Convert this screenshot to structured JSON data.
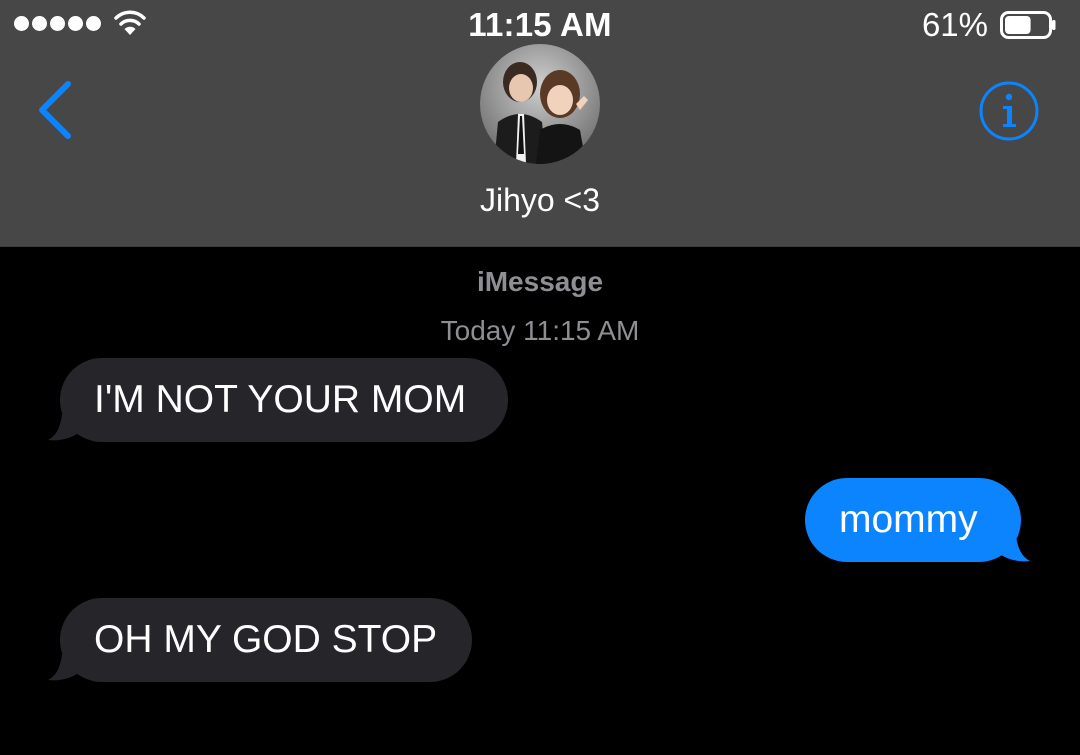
{
  "status_bar": {
    "time": "11:15 AM",
    "battery_percent": "61%",
    "battery_level": 0.61,
    "signal_dots": 5,
    "wifi_icon": "wifi-icon"
  },
  "header": {
    "back_icon": "chevron-left-icon",
    "avatar": "contact-photo",
    "contact_name": "Jihyo <3",
    "info_icon": "info-icon"
  },
  "conversation": {
    "service": "iMessage",
    "timestamp": "Today 11:15 AM",
    "messages": [
      {
        "direction": "incoming",
        "text": "I'M NOT YOUR MOM"
      },
      {
        "direction": "outgoing",
        "text": "mommy"
      },
      {
        "direction": "incoming",
        "text": "OH MY GOD STOP"
      }
    ]
  },
  "colors": {
    "header_bg": "#474747",
    "accent_blue": "#0b84fe",
    "incoming_bubble": "#26252a",
    "outgoing_bubble": "#0b84fe",
    "meta_text": "#8e8e93",
    "background": "#000000"
  }
}
